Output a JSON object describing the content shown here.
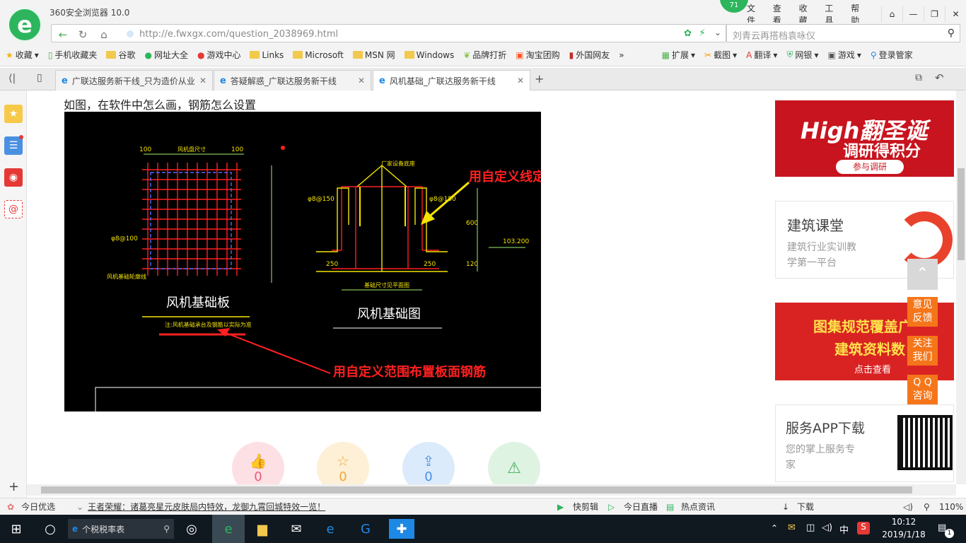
{
  "titlebar": {
    "app_title": "360安全浏览器 10.0",
    "badge": "71",
    "menu": [
      "文件",
      "查看",
      "收藏",
      "工具",
      "帮助"
    ]
  },
  "address": {
    "url": "http://e.fwxgx.com/question_2038969.html",
    "search_placeholder": "刘青云再搭档袁咏仪"
  },
  "bookmarks": {
    "items": [
      "收藏",
      "手机收藏夹",
      "谷歌",
      "网址大全",
      "游戏中心",
      "Links",
      "Microsoft",
      "MSN 网",
      "Windows",
      "品牌打折",
      "淘宝团购",
      "外国网友"
    ],
    "more": "»",
    "right_items": [
      "扩展",
      "截图",
      "翻译",
      "网银",
      "游戏",
      "登录管家"
    ]
  },
  "tabs": [
    {
      "title": "广联达服务新干线_只为造价从业",
      "active": false
    },
    {
      "title": "答疑解惑_广联达服务新干线",
      "active": false
    },
    {
      "title": "风机基础_广联达服务新干线",
      "active": true
    }
  ],
  "question": {
    "text": "如图，在软件中怎么画，钢筋怎么设置"
  },
  "cad": {
    "labels": {
      "plate_title": "风机基础板",
      "section_title": "风机基础图",
      "annot_line": "用自定义线定义",
      "annot_range": "用自定义范围布置板面钢筋",
      "dim_100a": "100",
      "dim_span": "风机盘尺寸",
      "dim_100b": "100",
      "rebar_left": "φ8@100",
      "edge_label": "风机基础轮廓线",
      "note": "注:风机基础承台及钢筋以实际为准",
      "top_label": "厂家设备底座",
      "rebar_sec": "φ8@150",
      "rebar_sec2": "φ8@150",
      "dim_600": "600",
      "elev": "103.200",
      "dim_250a": "250",
      "dim_250b": "250",
      "dim_120": "120",
      "base_dim": "基础尺寸见平面图"
    }
  },
  "actions": [
    {
      "icon": "thumbs-up",
      "count": "0"
    },
    {
      "icon": "star",
      "count": "0"
    },
    {
      "icon": "share",
      "count": "0"
    },
    {
      "icon": "warning",
      "count": ""
    }
  ],
  "sidebar": {
    "ad1": {
      "line1": "High翻圣诞",
      "line2": "调研得积分",
      "button": "参与调研"
    },
    "ad2": {
      "title": "建筑课堂",
      "desc1": "建筑行业实训教",
      "desc2": "学第一平台"
    },
    "ad3": {
      "line1": "图集规范覆盖广",
      "line2": "建筑资料数",
      "button": "点击查看"
    },
    "ad4": {
      "title": "服务APP下载",
      "desc1": "您的掌上服务专",
      "desc2": "家"
    }
  },
  "floating": {
    "feedback": [
      "意见",
      "反馈"
    ],
    "follow": [
      "关注",
      "我们"
    ],
    "qq": [
      "Q Q",
      "咨询"
    ]
  },
  "statusbar": {
    "today": "今日优选",
    "news": "王者荣耀：诸葛亮星元皮肤局内特效，龙御九霄回城特效一览！",
    "right": [
      "快剪辑",
      "今日直播",
      "热点资讯",
      "下载"
    ],
    "zoom": "110%"
  },
  "taskbar": {
    "search": "个税税率表",
    "time": "10:12",
    "date": "2019/1/18",
    "ime": "中",
    "notify": "1"
  },
  "colors": {
    "brand_green": "#2db55d",
    "float_orange": "#f5761a",
    "cad_yellow": "#f5e400",
    "cad_red": "#ff1a1a"
  }
}
